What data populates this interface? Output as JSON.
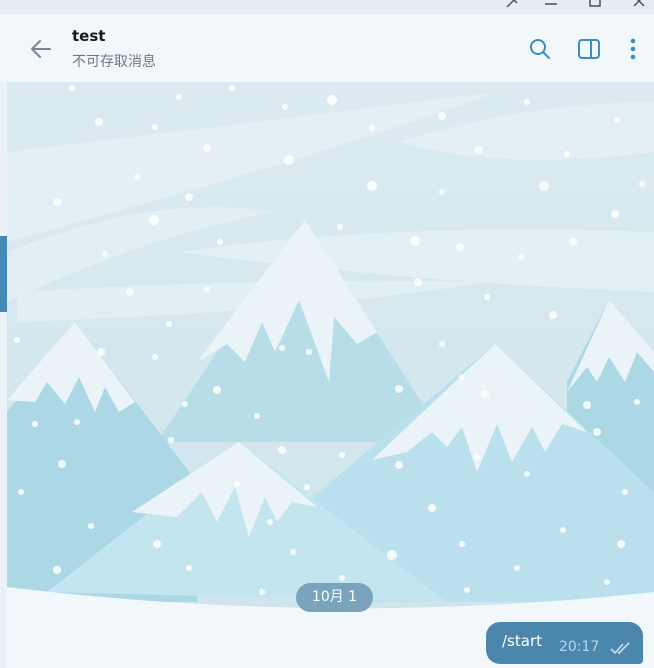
{
  "header": {
    "title": "test",
    "subtitle": "不可存取消息"
  },
  "chat": {
    "date_label": "10月 1",
    "message": {
      "text": "/start",
      "time": "20:17",
      "status": "read"
    }
  },
  "icons": {
    "back": "arrow-left-icon",
    "search": "search-icon",
    "sidebar": "sidebar-toggle-icon",
    "more": "more-vertical-icon",
    "pin": "pin-icon",
    "minimize": "minimize-icon",
    "maximize": "maximize-icon",
    "close": "close-icon"
  },
  "colors": {
    "accent": "#4589b6",
    "bubble": "#4b86ad",
    "date_pill": "#7aa3bd",
    "header_bg": "#f2f7fb"
  }
}
